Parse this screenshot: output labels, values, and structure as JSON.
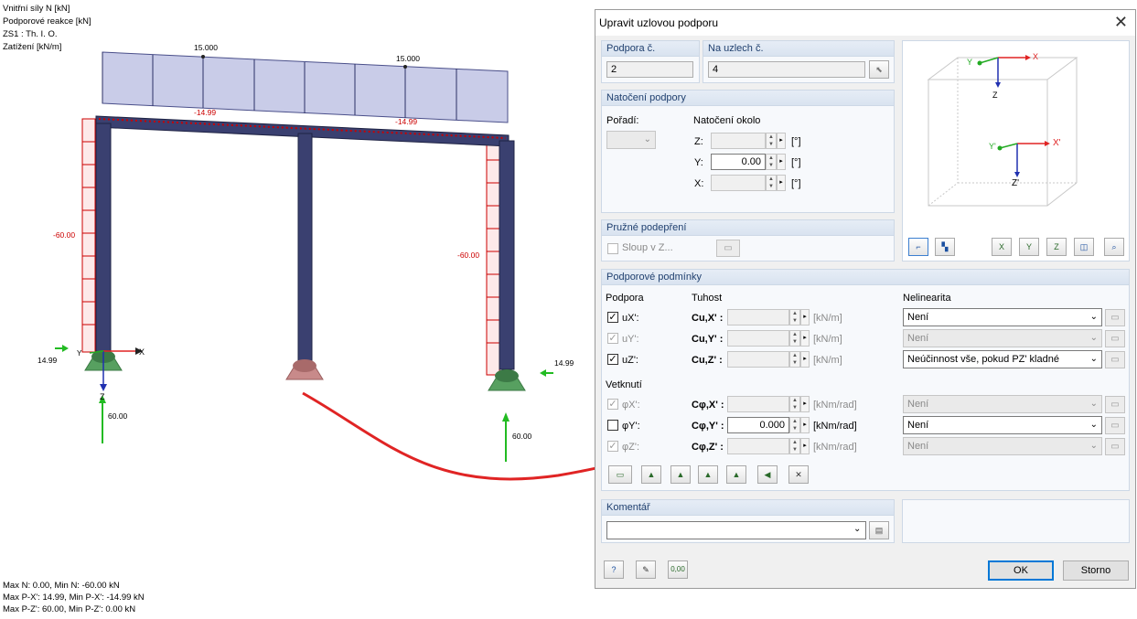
{
  "viewport": {
    "info_lines": [
      "Vnitřní síly N [kN]",
      "Podporové reakce [kN]",
      "ZS1 : Th. I. O.",
      "Zatížení [kN/m]"
    ],
    "load_labels": [
      "15.000",
      "15.000"
    ],
    "beam_labels": [
      "-14.99",
      "-14.99"
    ],
    "column_labels": [
      "-60.00",
      "-60.00"
    ],
    "reaction_labels": [
      "14.99",
      "14.99",
      "60.00",
      "60.00"
    ],
    "axis_labels": {
      "x": "X",
      "y": "Y",
      "z": "Z"
    },
    "summary_lines": [
      "Max N: 0.00, Min N: -60.00 kN",
      "Max P-X': 14.99, Min P-X': -14.99 kN",
      "Max P-Z': 60.00, Min P-Z': 0.00 kN"
    ],
    "colors": {
      "load": "#c9cce8",
      "frame": "#2f3560",
      "n_diagram": "#cc0000",
      "reaction": "#22bb22",
      "arrow": "#e02424"
    }
  },
  "dialog": {
    "title": "Upravit uzlovou podporu",
    "close_icon": "close-icon",
    "support_no": {
      "label": "Podpora č.",
      "value": "2"
    },
    "on_nodes": {
      "label": "Na uzlech č.",
      "value": "4"
    },
    "rotation": {
      "title": "Natočení podpory",
      "order_label": "Pořadí:",
      "about_label": "Natočení okolo",
      "axes": [
        {
          "label": "Z:",
          "value": "",
          "unit": "[°]",
          "enabled": false
        },
        {
          "label": "Y:",
          "value": "0.00",
          "unit": "[°]",
          "enabled": true
        },
        {
          "label": "X:",
          "value": "",
          "unit": "[°]",
          "enabled": false
        }
      ]
    },
    "elastic": {
      "title": "Pružné podepření",
      "column_label": "Sloup v Z..."
    },
    "preview": {
      "axes": {
        "x": "X",
        "y": "Y",
        "z": "Z",
        "x2": "X'",
        "y2": "Y'",
        "z2": "Z'"
      },
      "toolbar_icons": [
        "axis-system-icon",
        "view-colors-icon",
        "view-x-icon",
        "view-y-icon",
        "view-z-icon",
        "isometric-icon",
        "zoom-reset-icon"
      ],
      "toolbar_labels": [
        "X",
        "Y",
        "Z"
      ]
    },
    "conditions": {
      "title": "Podporové podmínky",
      "support_header": "Podpora",
      "stiffness_header": "Tuhost",
      "nonlin_header": "Nelinearita",
      "translations": [
        {
          "label": "uX':",
          "checked": true,
          "enabled": true,
          "stiff_label": "Cu,X' :",
          "unit": "[kN/m]",
          "value": "",
          "nonlin": "Není",
          "nonlin_enabled": true
        },
        {
          "label": "uY':",
          "checked": true,
          "enabled": false,
          "stiff_label": "Cu,Y' :",
          "unit": "[kN/m]",
          "value": "",
          "nonlin": "Není",
          "nonlin_enabled": false
        },
        {
          "label": "uZ':",
          "checked": true,
          "enabled": true,
          "stiff_label": "Cu,Z' :",
          "unit": "[kN/m]",
          "value": "",
          "nonlin": "Neúčinnost vše, pokud PZ' kladné",
          "nonlin_enabled": true
        }
      ],
      "fixity_header": "Vetknutí",
      "rotations": [
        {
          "label": "φX':",
          "checked": true,
          "enabled": false,
          "stiff_label": "Cφ,X' :",
          "unit": "[kNm/rad]",
          "value": "",
          "nonlin": "Není",
          "nonlin_enabled": false
        },
        {
          "label": "φY':",
          "checked": false,
          "enabled": true,
          "stiff_label": "Cφ,Y' :",
          "unit": "[kNm/rad]",
          "value": "0.000",
          "nonlin": "Není",
          "nonlin_enabled": true
        },
        {
          "label": "φZ':",
          "checked": true,
          "enabled": false,
          "stiff_label": "Cφ,Z' :",
          "unit": "[kNm/rad]",
          "value": "",
          "nonlin": "Není",
          "nonlin_enabled": false
        }
      ],
      "type_buttons": [
        "free-support-icon",
        "hinged-support-icon",
        "fixed-support-icon",
        "roller-x-icon",
        "roller-y-icon",
        "wall-support-icon",
        "release-all-icon"
      ]
    },
    "comment": {
      "title": "Komentář",
      "value": ""
    },
    "footer": {
      "ok": "OK",
      "cancel": "Storno",
      "units_label": "0,00"
    }
  }
}
